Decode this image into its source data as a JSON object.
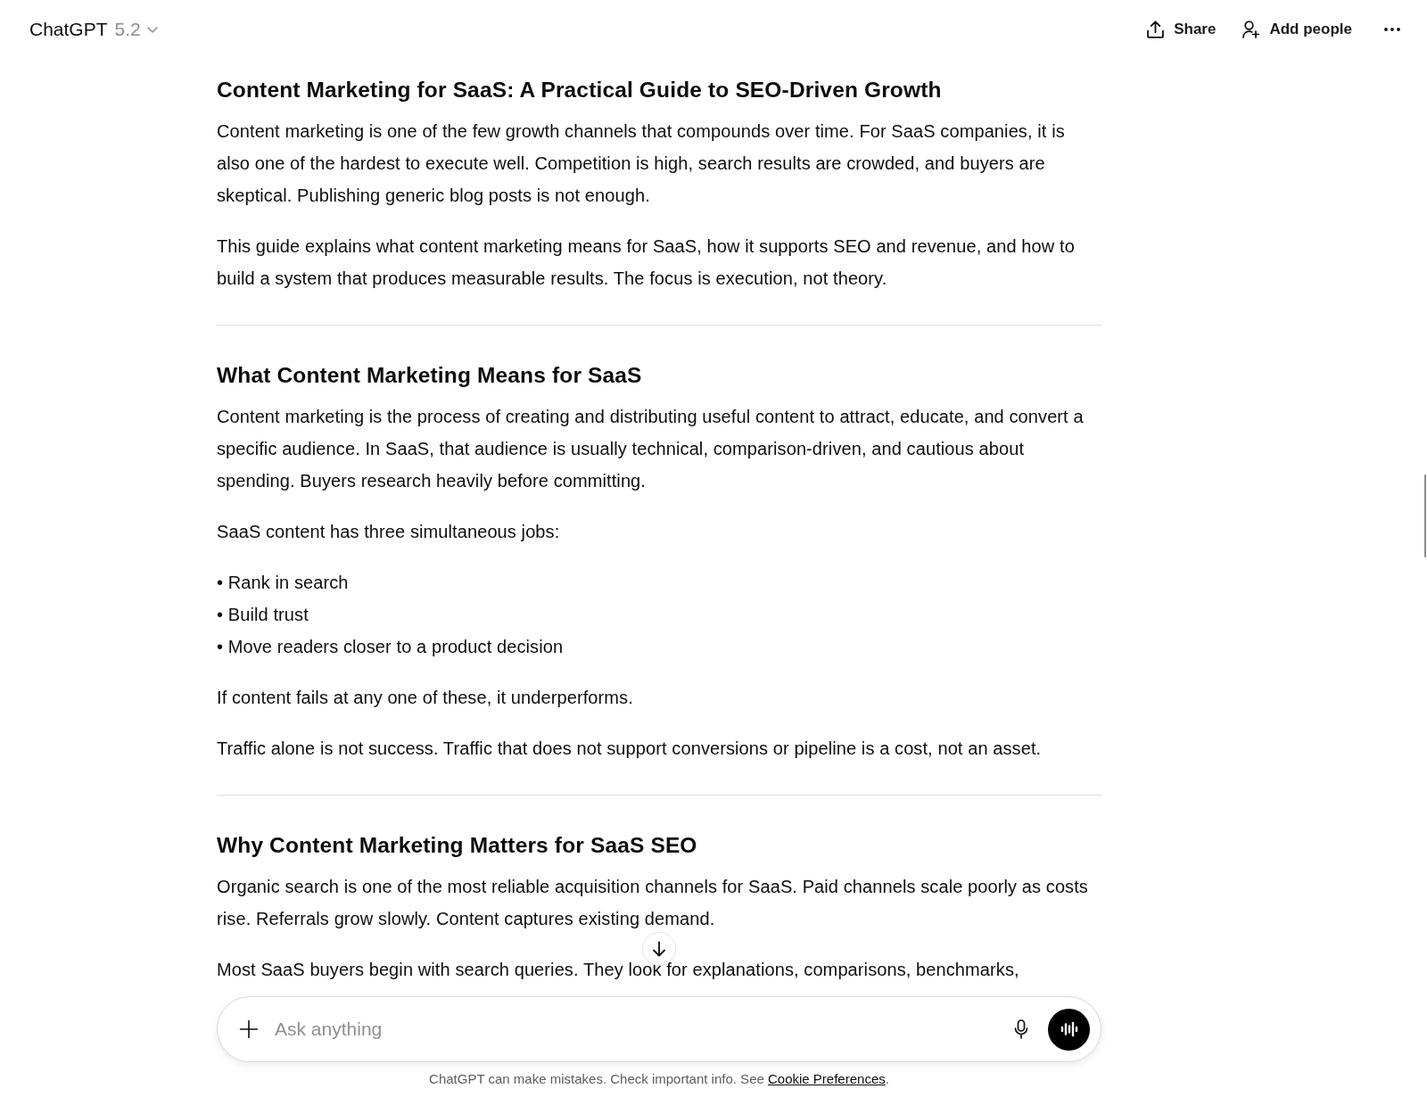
{
  "header": {
    "model_selector": {
      "name": "ChatGPT",
      "version": "5.2"
    },
    "actions": [
      {
        "kind": "share",
        "label": "Share"
      },
      {
        "kind": "add_people",
        "label": "Add people"
      },
      {
        "kind": "more"
      }
    ]
  },
  "article": {
    "blocks": [
      {
        "kind": "heading",
        "text": "Content Marketing for SaaS: A Practical Guide to SEO-Driven Growth"
      },
      {
        "kind": "paragraph",
        "text": "Content marketing is one of the few growth channels that compounds over time. For SaaS companies, it is also one of the hardest to execute well. Competition is high, search results are crowded, and buyers are skeptical. Publishing generic blog posts is not enough."
      },
      {
        "kind": "paragraph",
        "text": "This guide explains what content marketing means for SaaS, how it supports SEO and revenue, and how to build a system that produces measurable results. The focus is execution, not theory."
      },
      {
        "kind": "divider"
      },
      {
        "kind": "heading",
        "text": "What Content Marketing Means for SaaS"
      },
      {
        "kind": "paragraph",
        "text": "Content marketing is the process of creating and distributing useful content to attract, educate, and convert a specific audience. In SaaS, that audience is usually technical, comparison-driven, and cautious about spending. Buyers research heavily before committing."
      },
      {
        "kind": "paragraph",
        "text": "SaaS content has three simultaneous jobs:"
      },
      {
        "kind": "list",
        "items": [
          "• Rank in search",
          "• Build trust",
          "• Move readers closer to a product decision"
        ]
      },
      {
        "kind": "paragraph",
        "text": "If content fails at any one of these, it underperforms."
      },
      {
        "kind": "paragraph",
        "text": "Traffic alone is not success. Traffic that does not support conversions or pipeline is a cost, not an asset."
      },
      {
        "kind": "divider"
      },
      {
        "kind": "heading",
        "text": "Why Content Marketing Matters for SaaS SEO"
      },
      {
        "kind": "paragraph",
        "text": "Organic search is one of the most reliable acquisition channels for SaaS. Paid channels scale poorly as costs rise. Referrals grow slowly. Content captures existing demand."
      },
      {
        "kind": "paragraph",
        "text": "Most SaaS buyers begin with search queries. They look for explanations, comparisons, benchmarks,"
      }
    ]
  },
  "composer": {
    "placeholder": "Ask anything"
  },
  "disclaimer": {
    "text": "ChatGPT can make mistakes. Check important info. See",
    "link": "Cookie Preferences",
    "end": "."
  }
}
